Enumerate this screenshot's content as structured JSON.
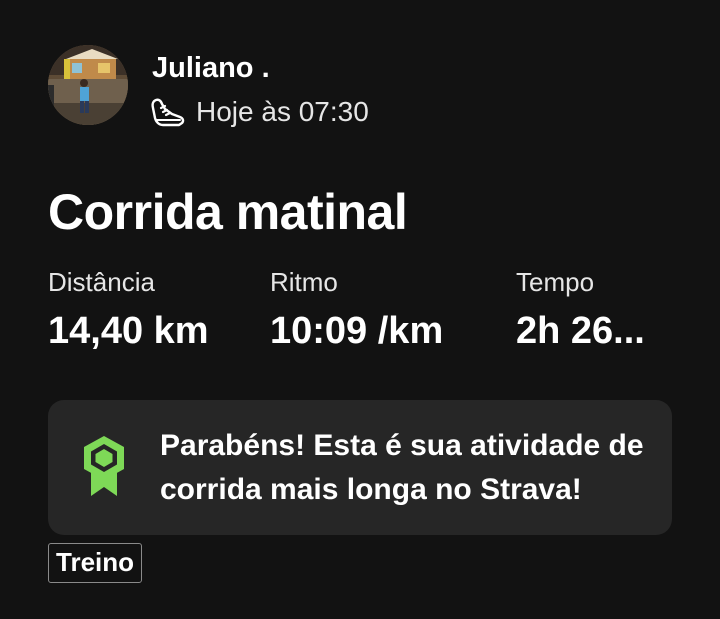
{
  "header": {
    "athlete_name": "Juliano .",
    "avatar_icon": "athlete-photo",
    "activity_type_icon": "running-shoe-icon",
    "timestamp": "Hoje às 07:30"
  },
  "activity": {
    "title": "Corrida matinal",
    "stats": [
      {
        "label": "Distância",
        "value": "14,40 km"
      },
      {
        "label": "Ritmo",
        "value": "10:09 /km"
      },
      {
        "label": "Tempo",
        "value": "2h 26..."
      }
    ]
  },
  "achievement": {
    "icon": "achievement-badge-icon",
    "text": "Parabéns! Esta é sua atividade de corrida mais longa no Strava!",
    "accent_color": "#7ED957"
  },
  "tag": {
    "label": "Treino"
  },
  "colors": {
    "background": "#121212",
    "card": "#262626",
    "text": "#FFFFFF"
  }
}
